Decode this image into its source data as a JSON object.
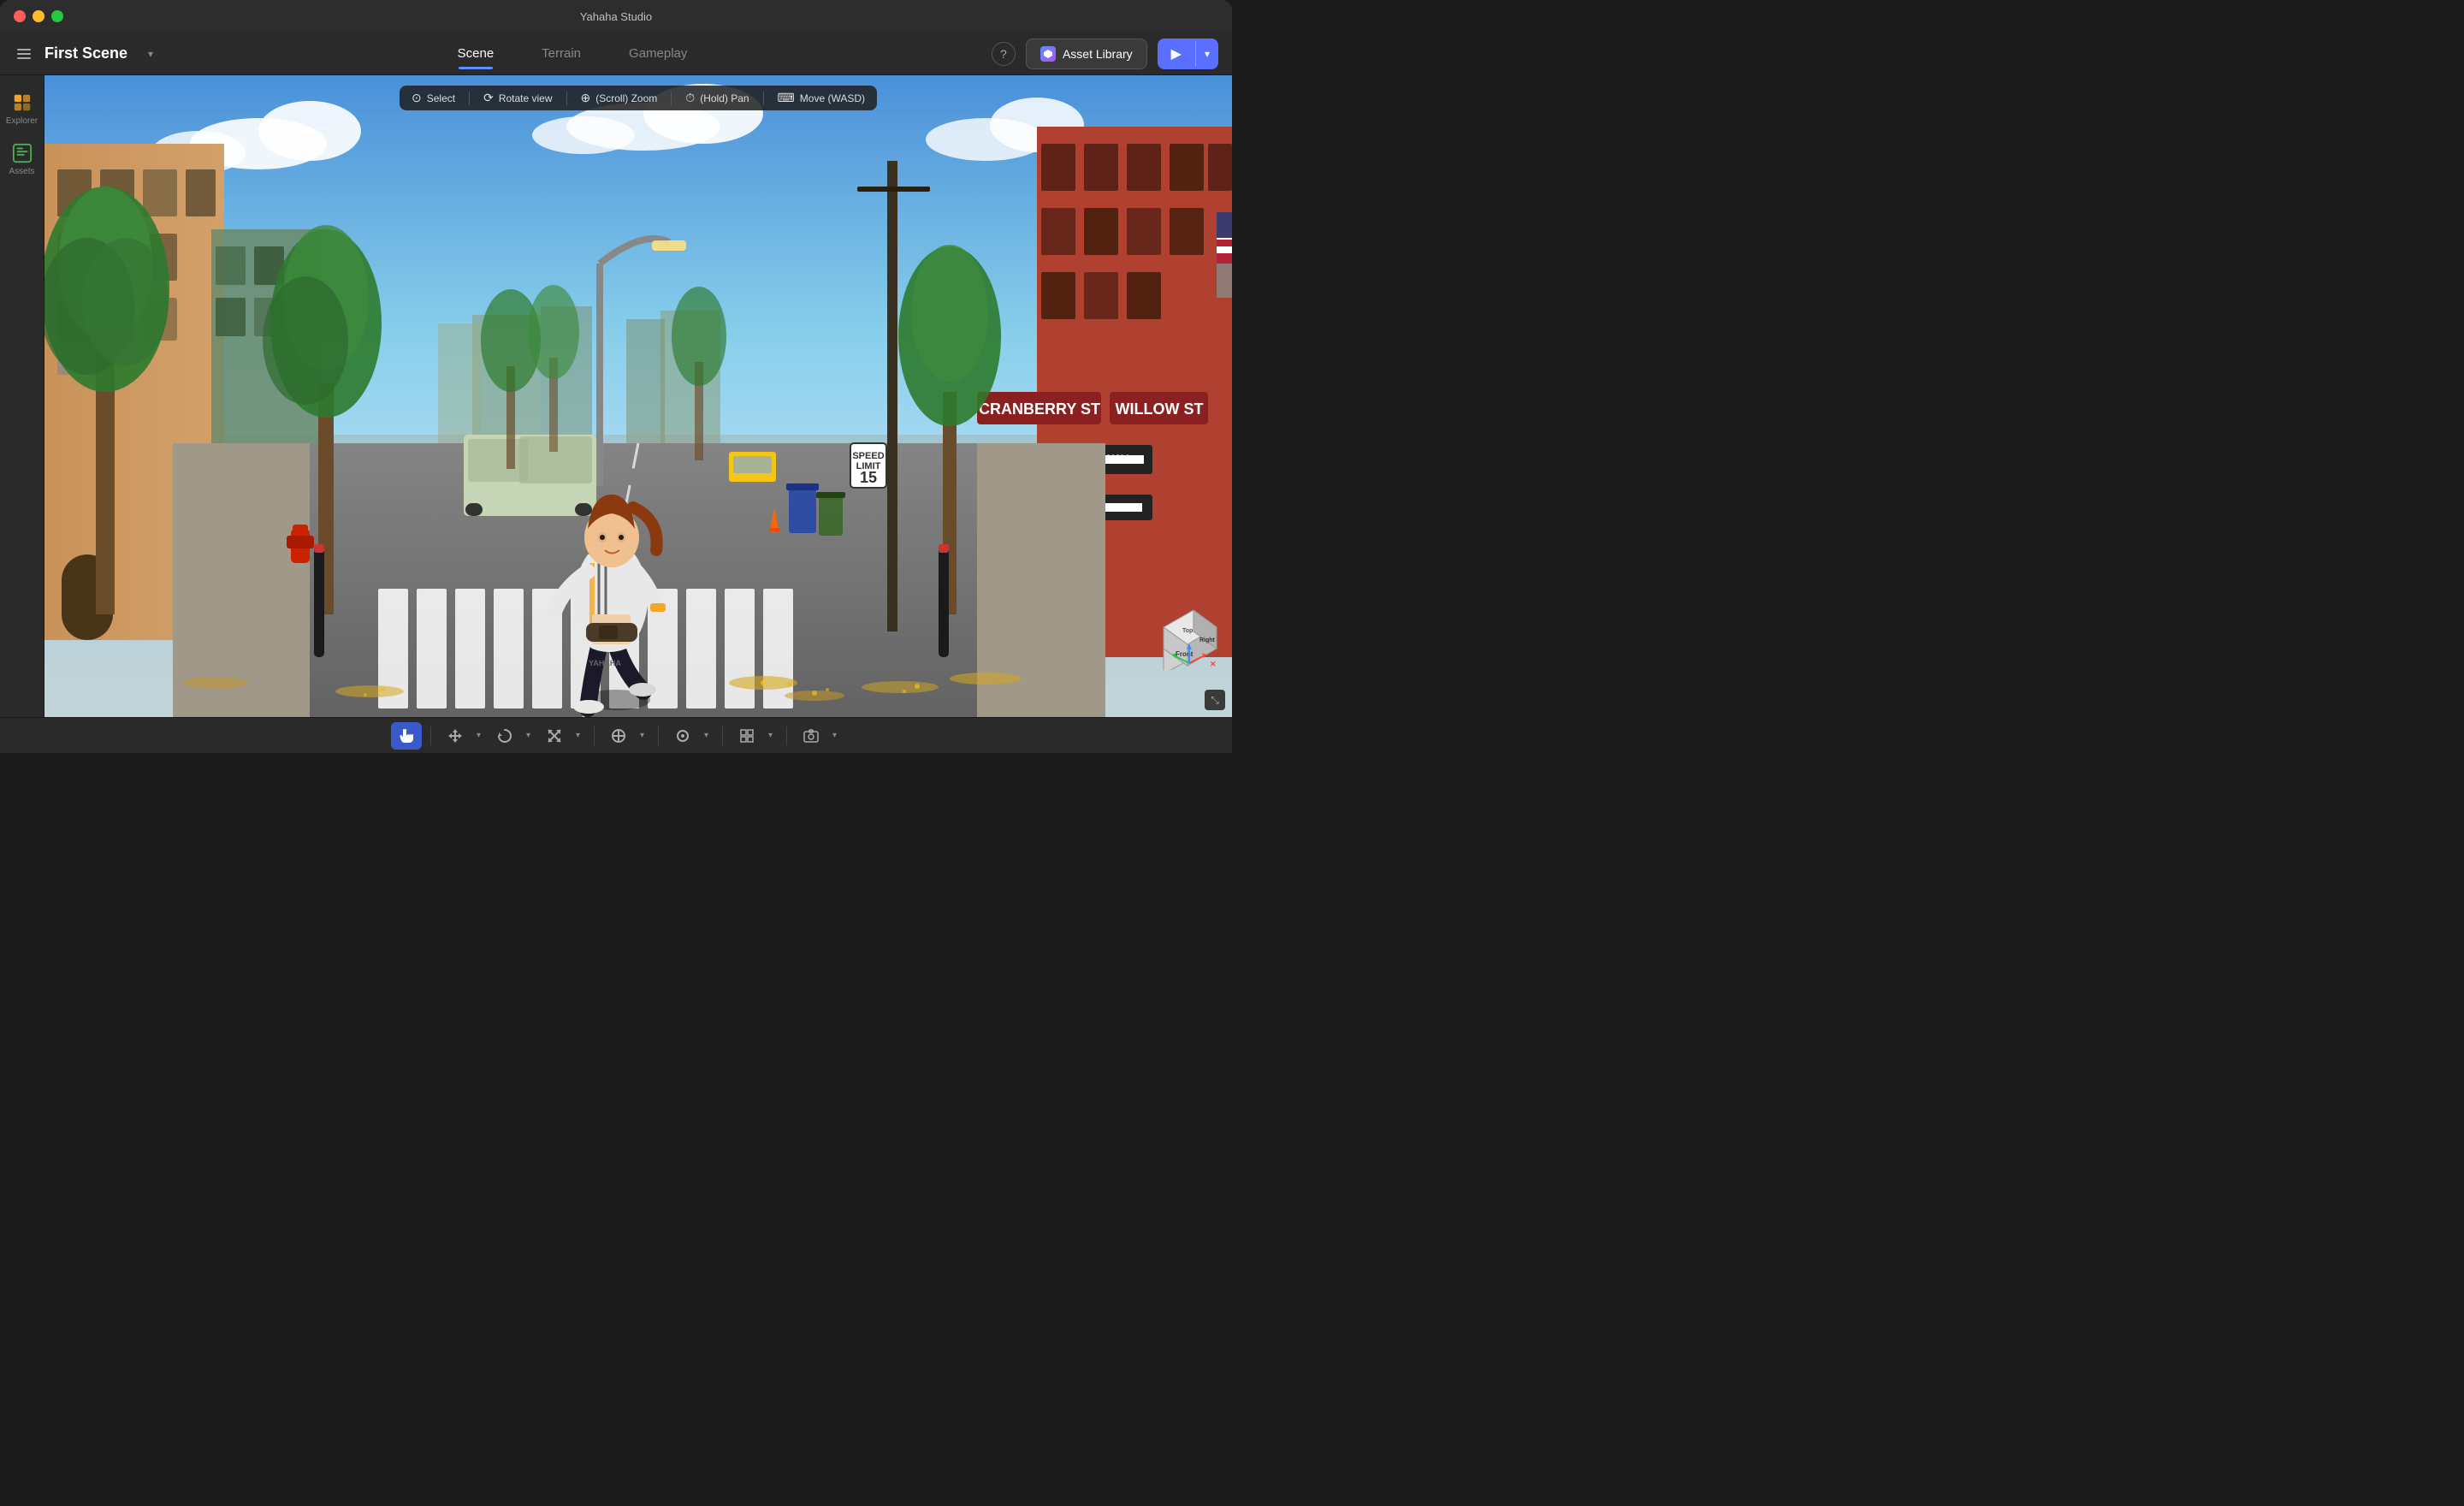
{
  "window": {
    "title": "Yahaha Studio"
  },
  "titlebar": {
    "scene_name": "First Scene"
  },
  "nav": {
    "tabs": [
      {
        "id": "scene",
        "label": "Scene",
        "active": true
      },
      {
        "id": "terrain",
        "label": "Terrain",
        "active": false
      },
      {
        "id": "gameplay",
        "label": "Gameplay",
        "active": false
      }
    ]
  },
  "toolbar": {
    "help_label": "?",
    "asset_library_label": "Asset Library",
    "play_label": "▶"
  },
  "sidebar": {
    "items": [
      {
        "id": "explorer",
        "label": "Explorer"
      },
      {
        "id": "assets",
        "label": "Assets"
      }
    ]
  },
  "viewport": {
    "tools": [
      {
        "id": "select",
        "icon": "⊙",
        "label": "Select"
      },
      {
        "id": "rotate",
        "icon": "⟳",
        "label": "Rotate view"
      },
      {
        "id": "zoom",
        "icon": "⊕",
        "label": "(Scroll) Zoom"
      },
      {
        "id": "pan",
        "icon": "⏱",
        "label": "(Hold) Pan"
      },
      {
        "id": "move",
        "icon": "⌨",
        "label": "Move (WASD)"
      }
    ]
  },
  "bottom_toolbar": {
    "tools": [
      {
        "id": "hand",
        "label": "Hand",
        "active": true,
        "icon": "✋"
      },
      {
        "id": "move",
        "label": "Move",
        "active": false,
        "icon": "✛"
      },
      {
        "id": "rotate",
        "label": "Rotate",
        "active": false,
        "icon": "↻"
      },
      {
        "id": "scale",
        "label": "Scale",
        "active": false,
        "icon": "⤡"
      },
      {
        "id": "transform",
        "label": "Transform",
        "active": false,
        "icon": "⊕"
      },
      {
        "id": "snap",
        "label": "Snap",
        "active": false,
        "icon": "⊙"
      },
      {
        "id": "grid",
        "label": "Grid",
        "active": false,
        "icon": "⊞"
      },
      {
        "id": "camera",
        "label": "Camera",
        "active": false,
        "icon": "▭"
      }
    ]
  },
  "orientation_cube": {
    "front_label": "Front",
    "right_label": "Right",
    "top_label": "Top"
  }
}
